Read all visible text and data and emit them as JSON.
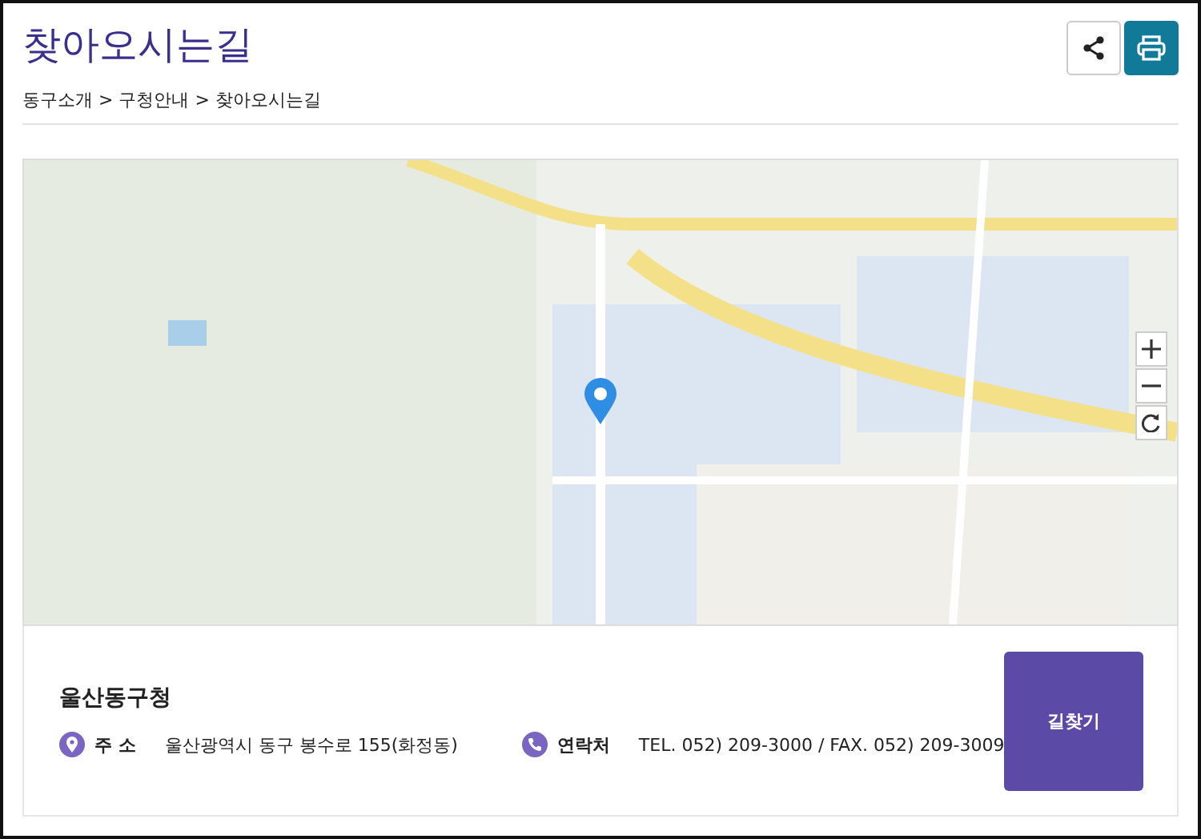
{
  "page": {
    "title": "찾아오시는길",
    "breadcrumb": "동구소개 > 구청안내 > 찾아오시는길"
  },
  "office": {
    "name": "울산동구청",
    "address_label": "주 소",
    "address": "울산광역시 동구 봉수로 155(화정동)",
    "contact_label": "연락처",
    "contact": "TEL. 052) 209-3000 / FAX. 052) 209-3009",
    "route_button": "길찾기"
  }
}
